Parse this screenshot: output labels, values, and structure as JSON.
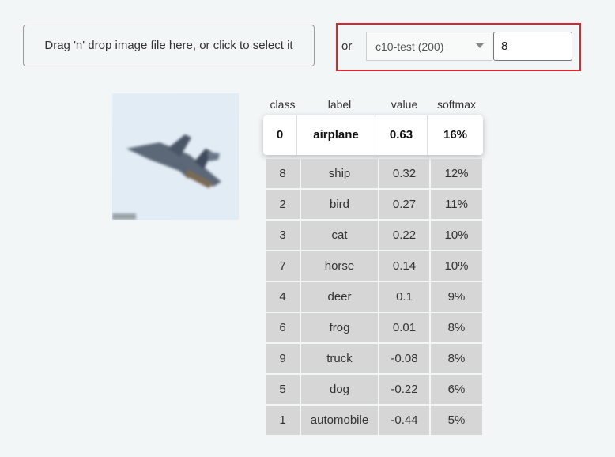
{
  "upload": {
    "dropzone_label": "Drag 'n' drop image file here, or click to select it"
  },
  "picker": {
    "or_label": "or",
    "dataset_selected": "c10-test (200)",
    "index_value": "8"
  },
  "image": {
    "icon": "airplane-image",
    "alt": ""
  },
  "table": {
    "headers": {
      "class": "class",
      "label": "label",
      "value": "value",
      "softmax": "softmax"
    },
    "top": {
      "class": "0",
      "label": "airplane",
      "value": "0.63",
      "softmax": "16%"
    },
    "rows": [
      {
        "class": "8",
        "label": "ship",
        "value": "0.32",
        "softmax": "12%"
      },
      {
        "class": "2",
        "label": "bird",
        "value": "0.27",
        "softmax": "11%"
      },
      {
        "class": "3",
        "label": "cat",
        "value": "0.22",
        "softmax": "10%"
      },
      {
        "class": "7",
        "label": "horse",
        "value": "0.14",
        "softmax": "10%"
      },
      {
        "class": "4",
        "label": "deer",
        "value": "0.1",
        "softmax": "9%"
      },
      {
        "class": "6",
        "label": "frog",
        "value": "0.01",
        "softmax": "8%"
      },
      {
        "class": "9",
        "label": "truck",
        "value": "-0.08",
        "softmax": "8%"
      },
      {
        "class": "5",
        "label": "dog",
        "value": "-0.22",
        "softmax": "6%"
      },
      {
        "class": "1",
        "label": "automobile",
        "value": "-0.44",
        "softmax": "5%"
      }
    ]
  },
  "colors": {
    "highlight_border": "#d9262a",
    "cell_bg": "#d6d6d6",
    "page_bg": "#f2f6f7"
  }
}
